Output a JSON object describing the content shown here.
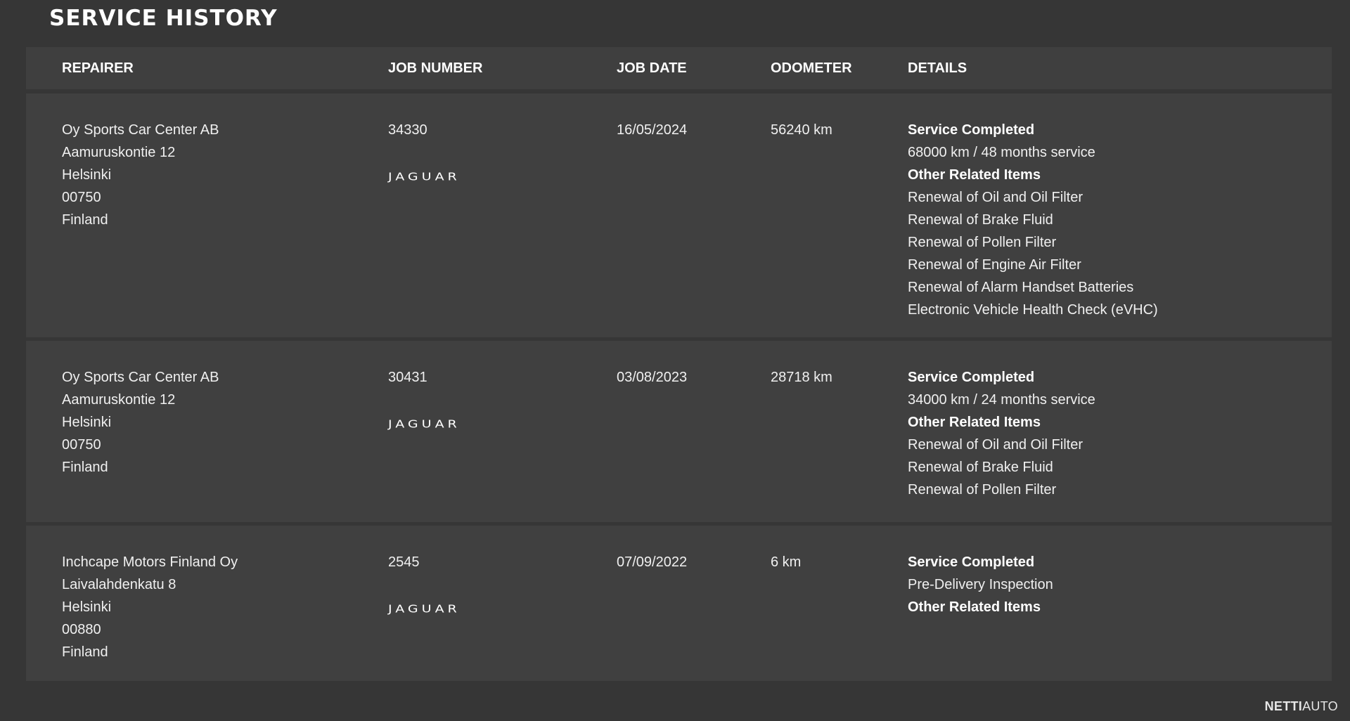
{
  "title": "SERVICE HISTORY",
  "columns": {
    "repairer": "REPAIRER",
    "job_number": "JOB NUMBER",
    "job_date": "JOB DATE",
    "odometer": "ODOMETER",
    "details": "DETAILS"
  },
  "records": [
    {
      "repairer": [
        "Oy Sports Car Center AB",
        "Aamuruskontie 12",
        "Helsinki",
        "00750",
        "Finland"
      ],
      "job_number": "34330",
      "brand": "JAGUAR",
      "job_date": "16/05/2024",
      "odometer": "56240 km",
      "details": {
        "heading": "Service Completed",
        "service": "68000 km / 48 months service",
        "other_heading": "Other Related Items",
        "items": [
          "Renewal of Oil and Oil Filter",
          "Renewal of Brake Fluid",
          "Renewal of Pollen Filter",
          "Renewal of Engine Air Filter",
          "Renewal of Alarm Handset Batteries",
          "Electronic Vehicle Health Check (eVHC)"
        ]
      }
    },
    {
      "repairer": [
        "Oy Sports Car Center AB",
        "Aamuruskontie 12",
        "Helsinki",
        "00750",
        "Finland"
      ],
      "job_number": "30431",
      "brand": "JAGUAR",
      "job_date": "03/08/2023",
      "odometer": "28718 km",
      "details": {
        "heading": "Service Completed",
        "service": "34000 km / 24 months service",
        "other_heading": "Other Related Items",
        "items": [
          "Renewal of Oil and Oil Filter",
          "Renewal of Brake Fluid",
          "Renewal of Pollen Filter"
        ]
      }
    },
    {
      "repairer": [
        "Inchcape Motors Finland Oy",
        "Laivalahdenkatu 8",
        "Helsinki",
        "00880",
        "Finland"
      ],
      "job_number": "2545",
      "brand": "JAGUAR",
      "job_date": "07/09/2022",
      "odometer": "6 km",
      "details": {
        "heading": "Service Completed",
        "service": "Pre-Delivery Inspection",
        "other_heading": "Other Related Items",
        "items": []
      }
    }
  ],
  "watermark": {
    "part1": "NETTI",
    "part2": "AUTO"
  }
}
